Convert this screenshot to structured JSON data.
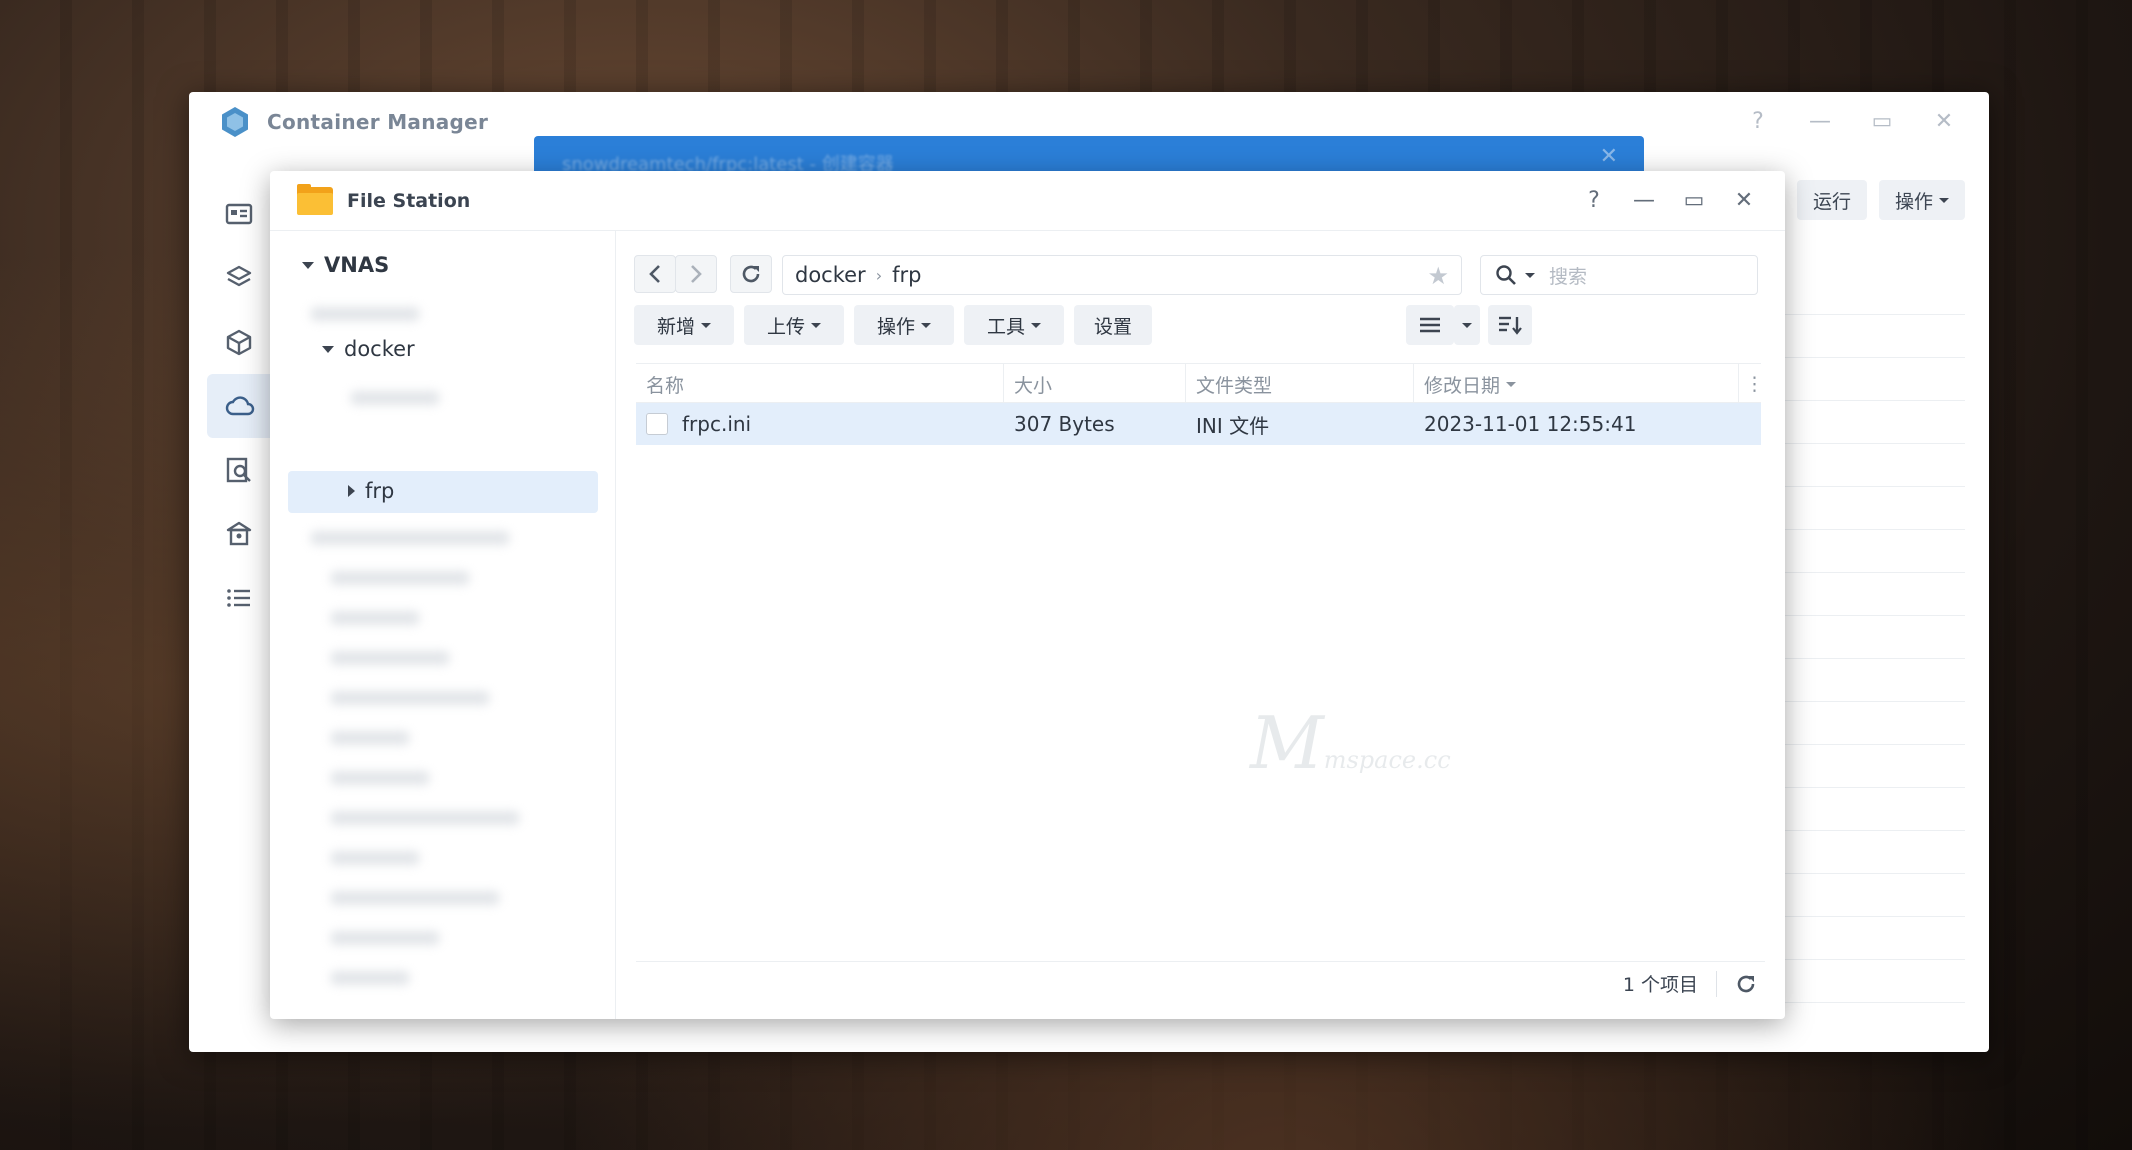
{
  "container_manager": {
    "title": "Container Manager",
    "buttons": {
      "run": "运行",
      "action": "操作"
    },
    "dialog_title_blurred": "snowdreamtech/frpc:latest - 创建容器",
    "window_controls": {
      "help": "?",
      "minimize": "—",
      "maximize": "▭",
      "close": "✕"
    }
  },
  "file_station": {
    "title": "File Station",
    "window_controls": {
      "help": "?",
      "minimize": "—",
      "maximize": "▭",
      "close": "✕"
    },
    "tree": {
      "root": "VNAS",
      "docker": "docker",
      "frp": "frp"
    },
    "path": {
      "segments": [
        "docker",
        "frp"
      ]
    },
    "search": {
      "placeholder": "搜索"
    },
    "toolbar": {
      "create": "新增",
      "upload": "上传",
      "action": "操作",
      "tools": "工具",
      "settings": "设置"
    },
    "columns": {
      "name": "名称",
      "size": "大小",
      "type": "文件类型",
      "modified": "修改日期"
    },
    "files": [
      {
        "name": "frpc.ini",
        "size": "307 Bytes",
        "type": "INI 文件",
        "modified": "2023-11-01 12:55:41"
      }
    ],
    "footer": {
      "count": "1 个项目"
    },
    "watermark": "M",
    "watermark_sub": "mspace.cc"
  },
  "colors": {
    "accent_blue": "#2b7fd8",
    "selection": "#e3eefb",
    "folder": "#fbbf35"
  }
}
